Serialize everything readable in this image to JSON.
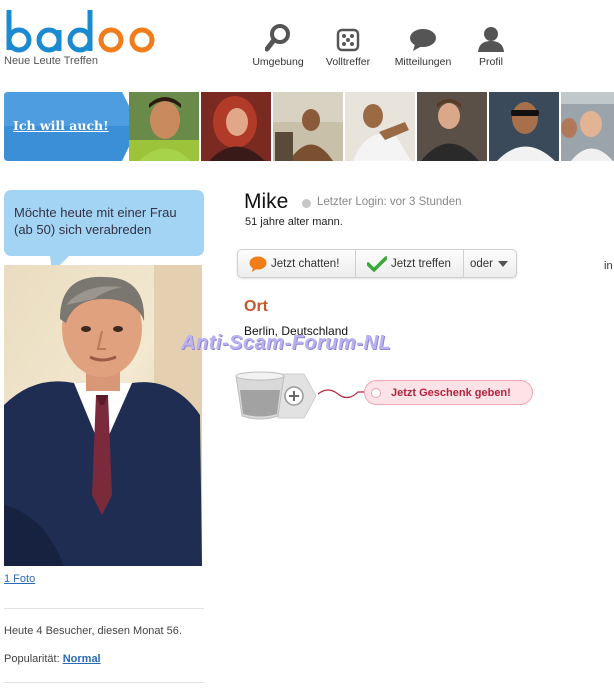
{
  "header": {
    "logo_text": "badoo",
    "tagline": "Neue Leute Treffen",
    "nav": [
      {
        "label": "Umgebung",
        "icon": "search-icon"
      },
      {
        "label": "Volltreffer",
        "icon": "dice-icon"
      },
      {
        "label": "Mitteilungen",
        "icon": "speech-bubble-icon"
      },
      {
        "label": "Profil",
        "icon": "person-icon"
      }
    ]
  },
  "strip": {
    "cta_label": "Ich will auch!"
  },
  "sidebar": {
    "status_message": "Möchte heute mit einer Frau (ab 50) sich verabreden",
    "photo_link": "1 Foto",
    "visitors": "Heute 4 Besucher, diesen Monat 56.",
    "popularity_label": "Popularität:",
    "popularity_value": "Normal"
  },
  "profile": {
    "name": "Mike",
    "last_login": "Letzter Login: vor 3 Stunden",
    "age_text": "51 jahre alter mann.",
    "actions": {
      "chat": "Jetzt chatten!",
      "meet": "Jetzt treffen",
      "more": "oder"
    },
    "location_title": "Ort",
    "location_value": "Berlin, Deutschland",
    "gift_button": "Jetzt Geschenk geben!",
    "edge_text": "in"
  },
  "watermark": "Anti-Scam-Forum-NL",
  "colors": {
    "logo_blue": "#1c8ad0",
    "logo_orange": "#f07c1a",
    "cta_blue": "#3b8fd6",
    "bubble_blue": "#a4d4f4",
    "ort_orange": "#c05a2a",
    "gift_pink": "#fde3e8"
  }
}
